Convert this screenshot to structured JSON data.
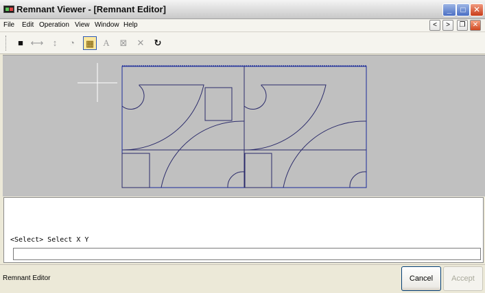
{
  "window": {
    "title": "Remnant Viewer - [Remnant Editor]",
    "minimize": "_",
    "maximize": "□",
    "close": "✕"
  },
  "menu": {
    "items": [
      "File",
      "Edit",
      "Operation",
      "View",
      "Window",
      "Help"
    ],
    "mdi_prev": "<",
    "mdi_next": ">",
    "mdi_restore": "❐",
    "mdi_close": "✕"
  },
  "toolbar": {
    "tools": [
      {
        "name": "select-square-icon",
        "glyph": "■"
      },
      {
        "name": "horizontal-dimension-icon",
        "glyph": "⟷"
      },
      {
        "name": "vertical-dimension-icon",
        "glyph": "↕"
      },
      {
        "name": "rotate-part-icon",
        "glyph": "◔"
      },
      {
        "name": "ruler-icon",
        "glyph": "▦"
      },
      {
        "name": "text-icon",
        "glyph": "A"
      },
      {
        "name": "delete-box-icon",
        "glyph": "⊠"
      },
      {
        "name": "cancel-x-icon",
        "glyph": "✕"
      },
      {
        "name": "refresh-icon",
        "glyph": "↻"
      }
    ]
  },
  "command": {
    "output": "<Select> Select X Y",
    "input_value": ""
  },
  "status": {
    "text": "Remnant Editor",
    "cancel_label": "Cancel",
    "accept_label": "Accept"
  },
  "colors": {
    "canvas_bg": "#c0c0c0",
    "outline": "#1a2a9a",
    "part_lines": "#2a2a6a",
    "crosshair": "#ffffff"
  }
}
